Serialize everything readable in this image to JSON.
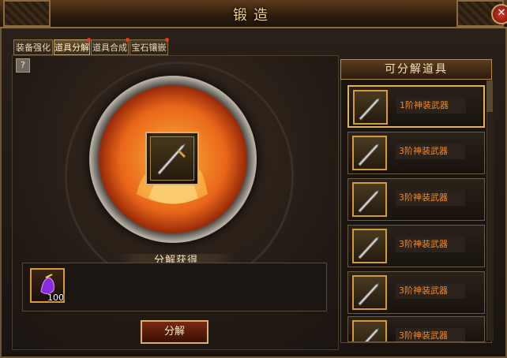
{
  "window": {
    "title": "锻造"
  },
  "tabs": [
    {
      "label": "装备强化"
    },
    {
      "label": "道具分解"
    },
    {
      "label": "道具合成"
    },
    {
      "label": "宝石镶嵌"
    }
  ],
  "help": {
    "label": "?"
  },
  "result": {
    "banner": "分解获得",
    "reward_count": "100"
  },
  "action": {
    "label": "分解"
  },
  "side": {
    "title": "可分解道具",
    "items": [
      {
        "label": "1阶神装武器"
      },
      {
        "label": "3阶神装武器"
      },
      {
        "label": "3阶神装武器"
      },
      {
        "label": "3阶神装武器"
      },
      {
        "label": "3阶神装武器"
      },
      {
        "label": "3阶神装武器"
      }
    ]
  },
  "colors": {
    "accent_gold": "#d8b06a",
    "label_orange": "#f08a2a",
    "fire": "#e8661a"
  }
}
